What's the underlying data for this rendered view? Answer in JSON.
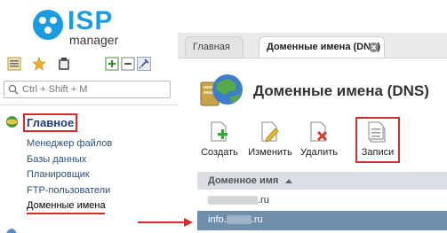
{
  "logo": {
    "brand": "ISP",
    "product": "manager"
  },
  "sidebar": {
    "toolbar_icons": [
      "list-icon",
      "star-icon",
      "clipboard-icon",
      "expand-icon",
      "collapse-icon",
      "pin-icon"
    ],
    "search": {
      "placeholder": "Ctrl + Shift + M",
      "value": ""
    },
    "group_title": "Главное",
    "items": [
      {
        "label": "Менеджер файлов"
      },
      {
        "label": "Базы данных"
      },
      {
        "label": "Планировщик"
      },
      {
        "label": "FTP-пользователи"
      },
      {
        "label": "Доменные имена",
        "active": true
      }
    ]
  },
  "tabs": [
    {
      "label": "Главная",
      "active": false
    },
    {
      "label": "Доменные имена (DNS)",
      "active": true
    }
  ],
  "page": {
    "title": "Доменные имена (DNS)"
  },
  "actions": [
    {
      "label": "Создать",
      "icon": "create-icon"
    },
    {
      "label": "Изменить",
      "icon": "edit-icon"
    },
    {
      "label": "Удалить",
      "icon": "delete-icon"
    },
    {
      "label": "Записи",
      "icon": "records-icon"
    }
  ],
  "table": {
    "column_header": "Доменное имя",
    "rows": [
      {
        "prefix": "",
        "suffix": ".ru",
        "selected": false
      },
      {
        "prefix": "info.",
        "suffix": ".ru",
        "selected": true
      }
    ]
  },
  "colors": {
    "accent": "#1c9ce0",
    "highlight_red": "#d42b2b",
    "selected_row": "#6f8eac"
  }
}
